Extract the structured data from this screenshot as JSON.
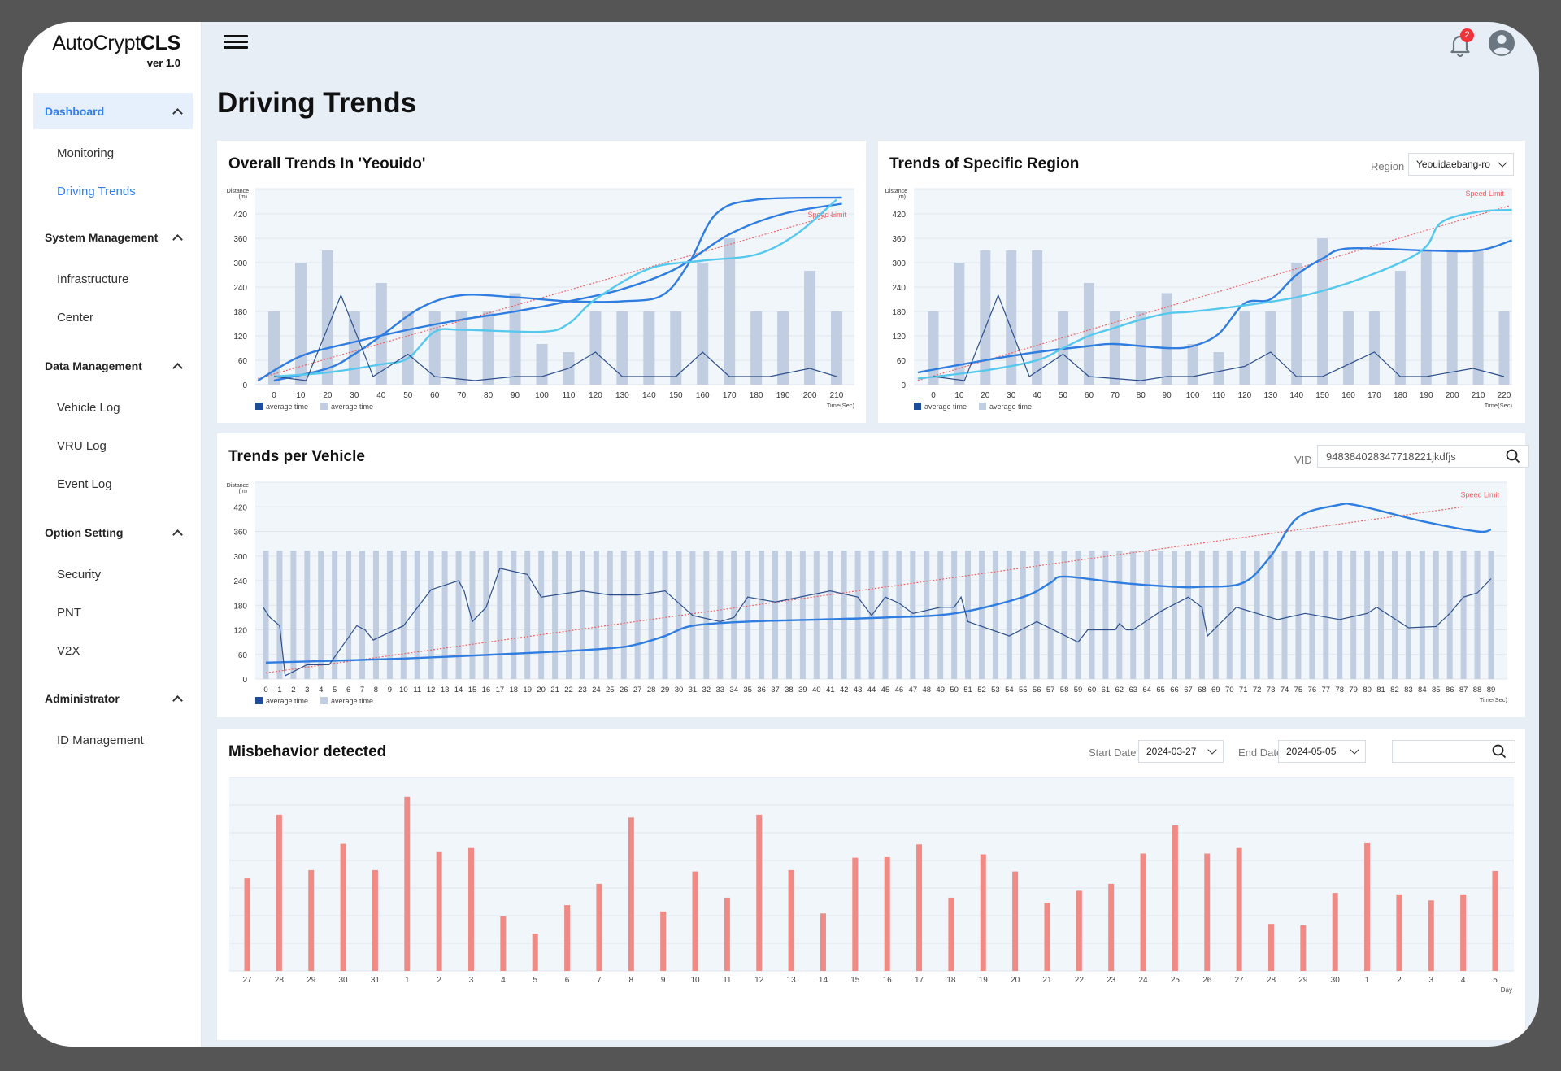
{
  "app": {
    "brand_light": "AutoCrypt",
    "brand_bold": "CLS",
    "version": "ver 1.0"
  },
  "sidebar": {
    "groups": [
      {
        "label": "Dashboard",
        "active": true,
        "items": [
          {
            "label": "Monitoring"
          },
          {
            "label": "Driving Trends",
            "active": true
          }
        ]
      },
      {
        "label": "System Management",
        "items": [
          {
            "label": "Infrastructure"
          },
          {
            "label": "Center"
          }
        ]
      },
      {
        "label": "Data Management",
        "items": [
          {
            "label": "Vehicle Log"
          },
          {
            "label": "VRU Log"
          },
          {
            "label": "Event Log"
          }
        ]
      },
      {
        "label": "Option Setting",
        "items": [
          {
            "label": "Security"
          },
          {
            "label": "PNT"
          },
          {
            "label": "V2X"
          }
        ]
      },
      {
        "label": "Administrator",
        "items": [
          {
            "label": "ID Management"
          }
        ]
      }
    ]
  },
  "header": {
    "notification_count": "2",
    "page_title": "Driving Trends"
  },
  "panels": {
    "overall": {
      "title": "Overall Trends  In 'Yeouido'"
    },
    "region": {
      "title": "Trends of Specific Region",
      "region_label": "Region",
      "region_value": "Yeouidaebang-ro"
    },
    "vehicle": {
      "title": "Trends per Vehicle",
      "vid_label": "VID",
      "vid_value": "948384028347718221jkdfjs"
    },
    "misbehavior": {
      "title": "Misbehavior detected",
      "start_label": "Start Date",
      "start_value": "2024-03-27",
      "end_label": "End Date",
      "end_value": "2024-05-05",
      "search_value": ""
    }
  },
  "colors": {
    "accent": "#2f80ed",
    "bar": "#c1cde0",
    "line_dark": "#2c4f8c",
    "curve_blue": "#2f7de0",
    "curve_cyan": "#56c8ee",
    "speed_limit": "#f06060",
    "misbehavior_bar": "#f08a84",
    "plot_bg": "#f1f6fb"
  },
  "chart_data": [
    {
      "id": "overall",
      "type": "bar",
      "title": "Overall Trends  In 'Yeouido'",
      "ylabel": "Distance\n(m)",
      "xlabel": "Time(Sec)",
      "ylim": [
        0,
        480
      ],
      "yticks": [
        0,
        60,
        120,
        180,
        240,
        300,
        360,
        420
      ],
      "categories": [
        0,
        10,
        20,
        30,
        40,
        50,
        60,
        70,
        80,
        90,
        100,
        110,
        120,
        130,
        140,
        150,
        160,
        170,
        180,
        190,
        200,
        210
      ],
      "legend": [
        "average time",
        "average time"
      ],
      "speed_limit_label": "Speed Limit",
      "speed_limit": {
        "x": [
          -6,
          210
        ],
        "y": [
          15,
          420
        ]
      },
      "bars": [
        180,
        300,
        330,
        180,
        250,
        180,
        180,
        180,
        180,
        225,
        100,
        80,
        180,
        180,
        180,
        180,
        300,
        360,
        180,
        180,
        280,
        180
      ],
      "line": {
        "x": [
          0,
          12,
          25,
          37,
          50,
          60,
          75,
          90,
          100,
          110,
          120,
          130,
          140,
          150,
          160,
          170,
          185,
          200,
          210
        ],
        "y": [
          20,
          10,
          220,
          20,
          75,
          20,
          10,
          20,
          20,
          40,
          80,
          20,
          20,
          20,
          80,
          20,
          20,
          40,
          20
        ]
      },
      "curves": [
        {
          "color": "blue",
          "x": [
            -6,
            10,
            30,
            50,
            70,
            90,
            110,
            130,
            150,
            170,
            190,
            212
          ],
          "y": [
            10,
            70,
            105,
            135,
            160,
            180,
            205,
            235,
            285,
            370,
            420,
            445
          ]
        },
        {
          "color": "blue",
          "x": [
            0,
            20,
            30,
            40,
            55,
            70,
            90,
            110,
            130,
            145,
            155,
            165,
            180,
            212
          ],
          "y": [
            10,
            40,
            75,
            120,
            190,
            220,
            215,
            205,
            205,
            220,
            300,
            420,
            455,
            460
          ]
        },
        {
          "color": "cyan",
          "x": [
            0,
            20,
            40,
            50,
            60,
            70,
            100,
            110,
            120,
            140,
            160,
            180,
            195,
            210
          ],
          "y": [
            20,
            30,
            50,
            65,
            130,
            135,
            130,
            150,
            210,
            285,
            305,
            320,
            370,
            455
          ]
        }
      ]
    },
    {
      "id": "region",
      "type": "bar",
      "title": "Trends of Specific Region",
      "ylabel": "Distance\n(m)",
      "xlabel": "Time(Sec)",
      "ylim": [
        0,
        480
      ],
      "yticks": [
        0,
        60,
        120,
        180,
        240,
        300,
        360,
        420
      ],
      "categories": [
        0,
        10,
        20,
        30,
        40,
        50,
        60,
        70,
        80,
        90,
        100,
        110,
        120,
        130,
        140,
        150,
        160,
        170,
        180,
        190,
        200,
        210,
        220
      ],
      "legend": [
        "average time",
        "average time"
      ],
      "speed_limit_label": "Speed Limit",
      "speed_limit": {
        "x": [
          -6,
          222
        ],
        "y": [
          10,
          440
        ]
      },
      "bars": [
        180,
        300,
        330,
        330,
        330,
        180,
        250,
        180,
        180,
        225,
        100,
        80,
        180,
        180,
        300,
        360,
        180,
        180,
        280,
        330,
        330,
        330,
        180
      ],
      "line": {
        "x": [
          0,
          12,
          25,
          37,
          50,
          60,
          80,
          90,
          100,
          120,
          130,
          140,
          150,
          170,
          180,
          190,
          208,
          220
        ],
        "y": [
          20,
          10,
          220,
          20,
          75,
          20,
          10,
          20,
          20,
          45,
          80,
          20,
          20,
          80,
          20,
          20,
          40,
          20
        ]
      },
      "curves": [
        {
          "color": "blue",
          "x": [
            -6,
            20,
            40,
            60,
            70,
            90,
            100,
            110,
            120,
            130,
            140,
            150,
            160,
            190,
            210,
            223
          ],
          "y": [
            30,
            60,
            80,
            95,
            100,
            90,
            95,
            125,
            200,
            210,
            270,
            310,
            335,
            330,
            330,
            355
          ]
        },
        {
          "color": "cyan",
          "x": [
            -6,
            20,
            40,
            50,
            60,
            70,
            80,
            90,
            100,
            120,
            140,
            160,
            180,
            190,
            196,
            210,
            223
          ],
          "y": [
            15,
            35,
            60,
            90,
            120,
            140,
            160,
            175,
            180,
            195,
            215,
            250,
            300,
            340,
            400,
            425,
            430
          ]
        }
      ]
    },
    {
      "id": "vehicle",
      "type": "bar",
      "title": "Trends per Vehicle",
      "ylabel": "Distance\n(m)",
      "xlabel": "Time(Sec)",
      "ylim": [
        0,
        480
      ],
      "yticks": [
        0,
        60,
        120,
        180,
        240,
        300,
        360,
        420
      ],
      "categories": [
        0,
        1,
        2,
        3,
        4,
        5,
        6,
        7,
        8,
        9,
        10,
        11,
        12,
        13,
        14,
        15,
        16,
        17,
        18,
        19,
        20,
        21,
        22,
        23,
        24,
        25,
        26,
        27,
        28,
        29,
        30,
        31,
        32,
        33,
        34,
        35,
        36,
        37,
        38,
        39,
        40,
        41,
        42,
        43,
        44,
        45,
        46,
        47,
        48,
        49,
        50,
        51,
        52,
        53,
        54,
        55,
        56,
        57,
        58,
        59,
        60,
        61,
        62,
        63,
        64,
        65,
        66,
        67,
        68,
        69,
        70,
        71,
        72,
        73,
        74,
        75,
        76,
        77,
        78,
        79,
        80,
        81,
        82,
        83,
        84,
        85,
        86,
        87,
        88,
        89
      ],
      "bar_value_all": 313,
      "legend": [
        "average time",
        "average time"
      ],
      "speed_limit_label": "Speed Limit",
      "speed_limit": {
        "x": [
          0,
          87
        ],
        "y": [
          15,
          420
        ]
      },
      "line": {
        "x": [
          -0.2,
          0.3,
          1,
          1.4,
          3,
          4.6,
          6.6,
          7.2,
          7.8,
          10,
          12,
          14,
          14.4,
          15,
          16,
          17,
          19,
          20,
          23,
          25,
          27,
          29,
          30,
          31,
          33,
          34,
          35,
          37,
          41,
          43,
          44,
          45,
          46,
          47,
          49,
          50,
          50.5,
          51,
          54,
          56,
          59,
          59.7,
          61.7,
          62,
          62.5,
          63,
          65,
          67,
          68,
          68.4,
          70.5,
          73.5,
          75.5,
          78,
          80,
          80.7,
          83,
          85,
          86,
          87,
          88,
          89
        ],
        "y": [
          175,
          150,
          130,
          8,
          35,
          35,
          130,
          120,
          95,
          130,
          218,
          240,
          215,
          140,
          175,
          270,
          255,
          200,
          215,
          205,
          205,
          215,
          185,
          155,
          140,
          150,
          200,
          188,
          215,
          200,
          155,
          200,
          185,
          160,
          175,
          175,
          200,
          140,
          105,
          140,
          90,
          120,
          120,
          135,
          120,
          120,
          165,
          200,
          175,
          105,
          175,
          145,
          160,
          145,
          160,
          175,
          125,
          128,
          160,
          200,
          210,
          245
        ]
      },
      "curves": [
        {
          "color": "blue",
          "x": [
            0,
            10,
            20,
            25,
            27,
            29,
            31,
            35,
            40,
            45,
            50,
            55,
            57,
            58,
            62,
            66,
            68,
            71,
            73,
            75,
            78,
            79,
            81,
            84,
            88,
            89
          ],
          "y": [
            40,
            50,
            65,
            75,
            85,
            105,
            130,
            140,
            145,
            150,
            160,
            200,
            235,
            250,
            235,
            225,
            225,
            235,
            300,
            395,
            425,
            425,
            410,
            385,
            360,
            365
          ]
        }
      ]
    },
    {
      "id": "misbehavior",
      "type": "bar",
      "title": "Misbehavior detected",
      "xlabel": "Day",
      "ylim": [
        0,
        7
      ],
      "yticks": [
        0,
        1,
        2,
        3,
        4,
        5,
        6,
        7
      ],
      "categories": [
        "27",
        "28",
        "29",
        "30",
        "31",
        "1",
        "2",
        "3",
        "4",
        "5",
        "6",
        "7",
        "8",
        "9",
        "10",
        "11",
        "12",
        "13",
        "14",
        "15",
        "16",
        "17",
        "18",
        "19",
        "20",
        "21",
        "22",
        "23",
        "24",
        "25",
        "26",
        "27",
        "28",
        "29",
        "30",
        "1",
        "2",
        "3",
        "4",
        "5"
      ],
      "values": [
        3.35,
        5.65,
        3.65,
        4.6,
        3.65,
        6.3,
        4.3,
        4.45,
        1.98,
        1.35,
        2.38,
        3.15,
        5.55,
        2.15,
        3.6,
        2.65,
        5.65,
        3.65,
        2.08,
        4.1,
        4.12,
        4.58,
        2.65,
        4.22,
        3.6,
        2.47,
        2.9,
        3.15,
        4.25,
        5.27,
        4.25,
        4.45,
        1.7,
        1.65,
        2.82,
        4.62,
        2.77,
        2.55,
        2.77,
        3.62
      ]
    }
  ]
}
